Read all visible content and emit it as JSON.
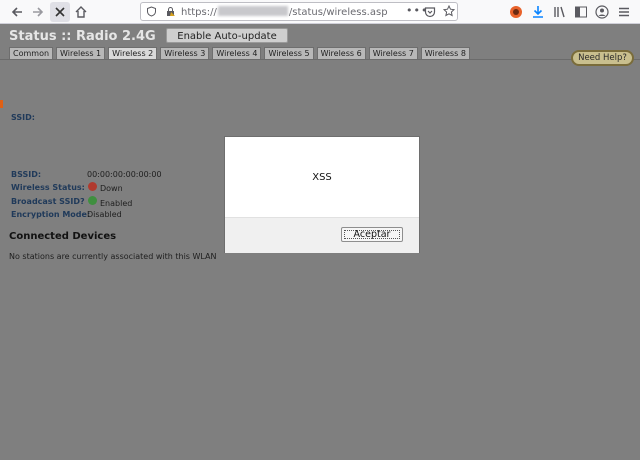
{
  "browser": {
    "url_prefix": "https://",
    "url_suffix": "/status/wireless.asp",
    "overflow_label": "•••"
  },
  "page": {
    "title": "Status :: Radio 2.4G",
    "autoupdate_label": "Enable Auto-update",
    "help_label": "Need Help?",
    "tabs": [
      {
        "label": "Common"
      },
      {
        "label": "Wireless 1"
      },
      {
        "label": "Wireless 2",
        "active": true
      },
      {
        "label": "Wireless 3"
      },
      {
        "label": "Wireless 4"
      },
      {
        "label": "Wireless 5"
      },
      {
        "label": "Wireless 6"
      },
      {
        "label": "Wireless 7"
      },
      {
        "label": "Wireless 8"
      }
    ]
  },
  "info": {
    "ssid_label": "SSID:",
    "bssid_label": "BSSID:",
    "bssid_value": "00:00:00:00:00:00",
    "wireless_status_label": "Wireless Status:",
    "wireless_status_value": "Down",
    "broadcast_label": "Broadcast SSID?",
    "broadcast_value": "Enabled",
    "encryption_label": "Encryption Mode:",
    "encryption_value": "Disabled"
  },
  "devices": {
    "title": "Connected Devices",
    "empty_message": "No stations are currently associated with this WLAN"
  },
  "modal": {
    "message": "XSS",
    "ok_label": "Aceptar"
  },
  "colors": {
    "overlay": "#7f7f7f",
    "help_button": "#c9bf8e",
    "status_down": "#b03a2e",
    "status_ok": "#3f8f3f"
  }
}
